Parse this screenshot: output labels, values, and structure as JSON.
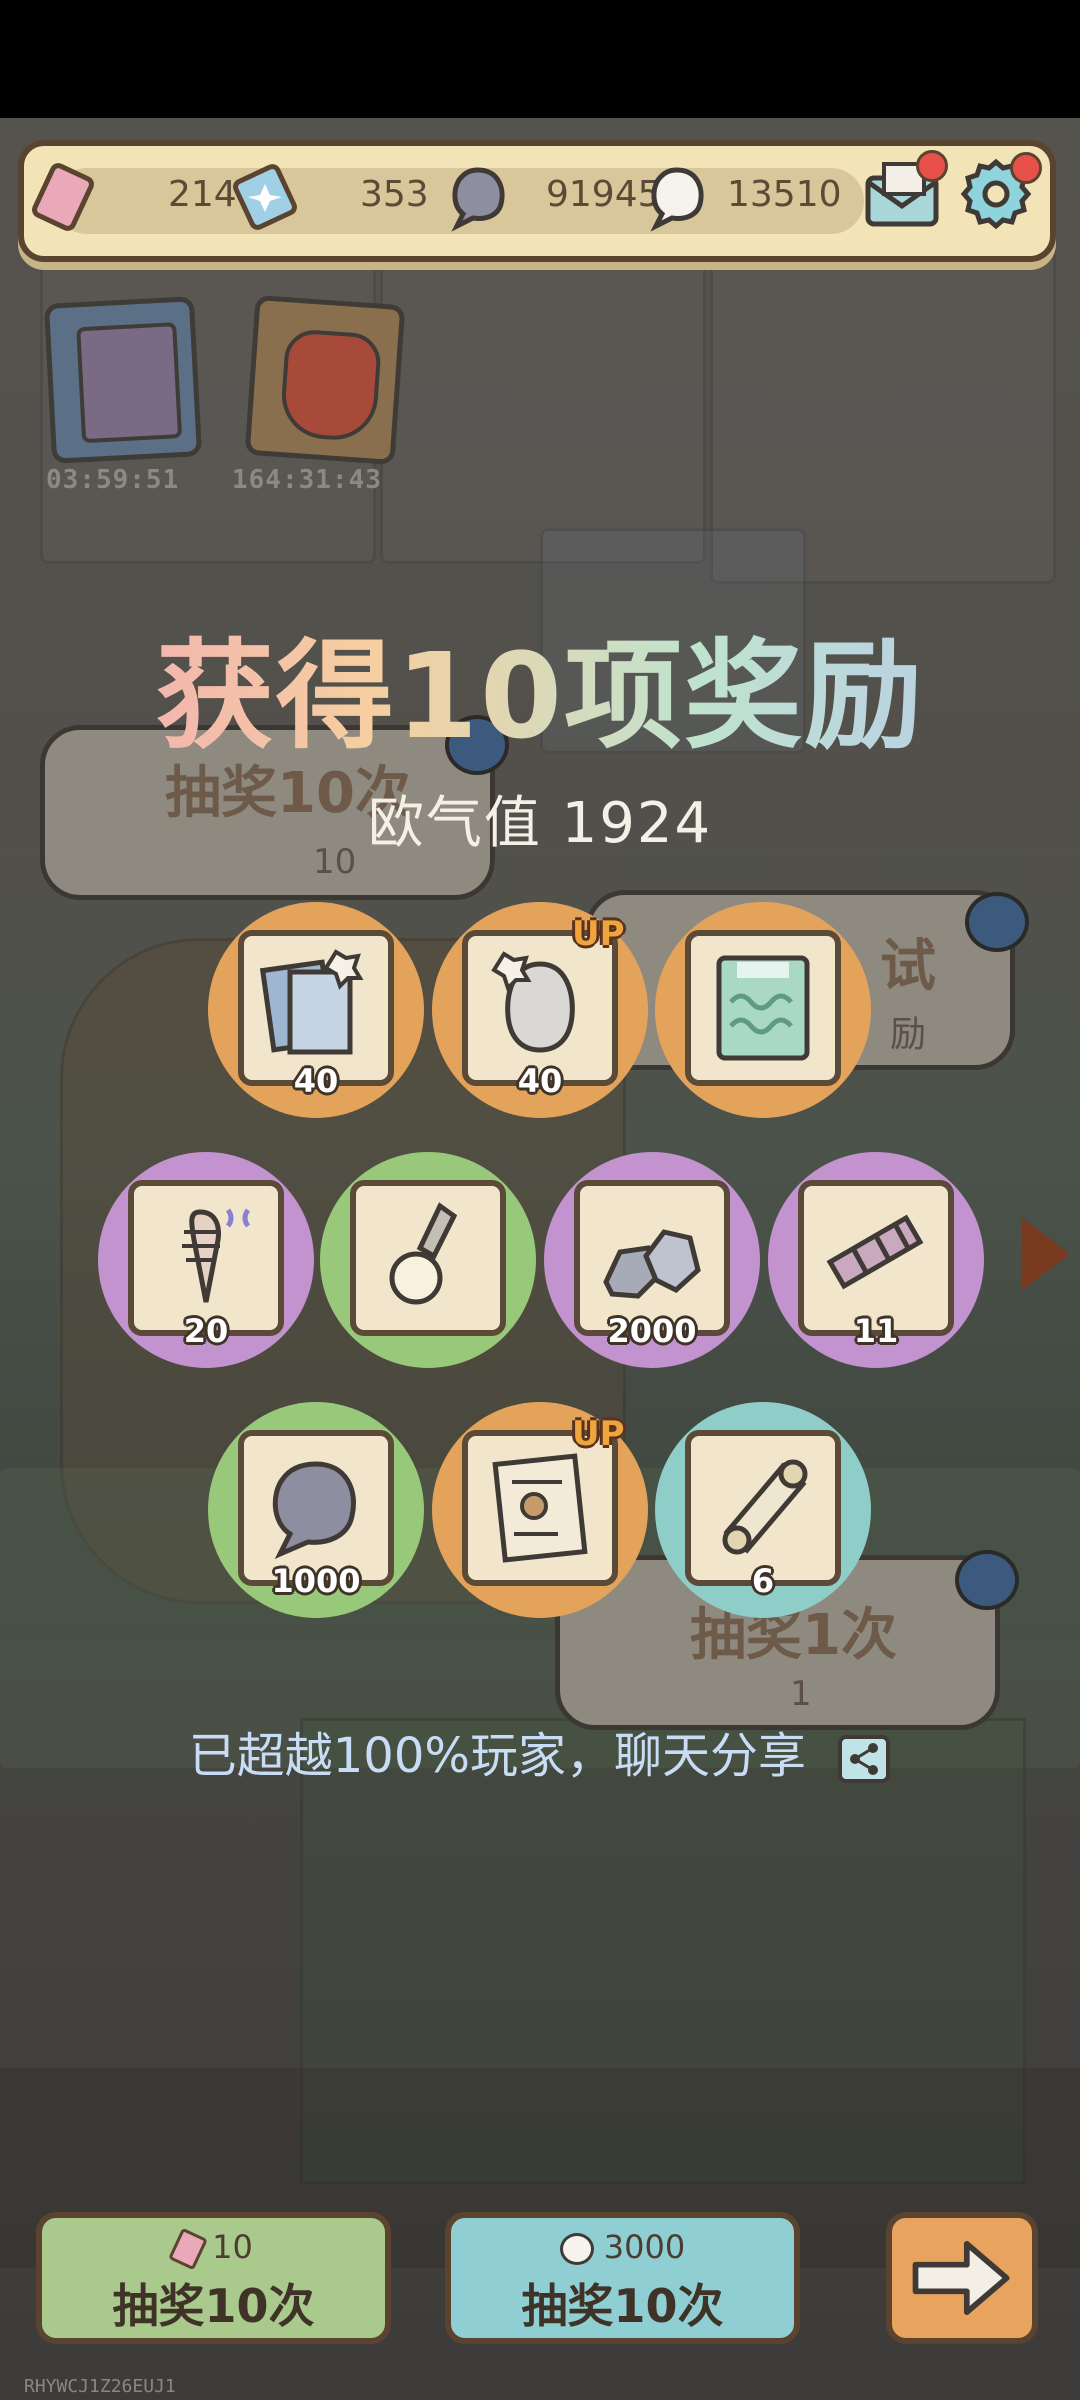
{
  "topbar": {
    "currencies": [
      {
        "icon": "ticket-icon",
        "value": "214"
      },
      {
        "icon": "gem-ticket-icon",
        "value": "353"
      },
      {
        "icon": "gray-blob-icon",
        "value": "91945"
      },
      {
        "icon": "white-ghost-icon",
        "value": "13510"
      }
    ]
  },
  "timers": [
    {
      "value": "03:59:51"
    },
    {
      "value": "164:31:43"
    }
  ],
  "background": {
    "draw10_label": "抽奖10次",
    "draw10_cost": "10",
    "test_label": "试",
    "test_sub": "励",
    "draw1_label": "抽奖1次",
    "draw1_cost": "1"
  },
  "overlay": {
    "title": "获得10项奖励",
    "luck_label": "欧气值 1924",
    "share_text": "已超越100%玩家，聊天分享"
  },
  "rewards": [
    {
      "name": "photo-cards",
      "qty": "40",
      "color": "orange",
      "up": false
    },
    {
      "name": "marble-bust",
      "qty": "40",
      "color": "orange",
      "up": true
    },
    {
      "name": "cell-card",
      "qty": "",
      "color": "orange",
      "up": false
    },
    {
      "name": "fish-skeleton",
      "qty": "20",
      "color": "purple",
      "up": false
    },
    {
      "name": "pearl-pendant",
      "qty": "",
      "color": "green",
      "up": false
    },
    {
      "name": "stones",
      "qty": "2000",
      "color": "purple",
      "up": false
    },
    {
      "name": "telescope",
      "qty": "11",
      "color": "purple",
      "up": false
    },
    {
      "name": "gray-blob",
      "qty": "1000",
      "color": "green",
      "up": false
    },
    {
      "name": "document",
      "qty": "",
      "color": "orange",
      "up": true
    },
    {
      "name": "scroll",
      "qty": "6",
      "color": "teal",
      "up": false
    }
  ],
  "up_badge": "UP",
  "bottom": {
    "left": {
      "cost": "10",
      "label": "抽奖10次"
    },
    "middle": {
      "cost": "3000",
      "label": "抽奖10次"
    }
  },
  "footer_code": "RHYWCJ1Z26EUJ1",
  "colors": {
    "orange": "#e3a35b",
    "purple": "#c393cf",
    "green": "#98c97a",
    "teal": "#8ecdc8"
  }
}
